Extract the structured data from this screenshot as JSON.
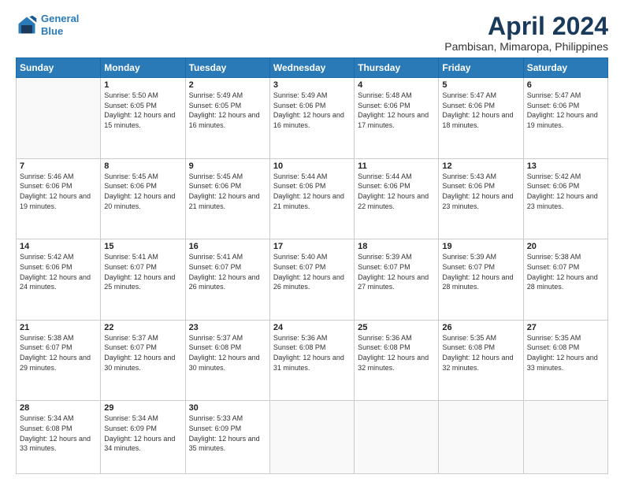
{
  "logo": {
    "line1": "General",
    "line2": "Blue"
  },
  "title": "April 2024",
  "subtitle": "Pambisan, Mimaropa, Philippines",
  "weekdays": [
    "Sunday",
    "Monday",
    "Tuesday",
    "Wednesday",
    "Thursday",
    "Friday",
    "Saturday"
  ],
  "weeks": [
    [
      {
        "day": "",
        "sunrise": "",
        "sunset": "",
        "daylight": ""
      },
      {
        "day": "1",
        "sunrise": "Sunrise: 5:50 AM",
        "sunset": "Sunset: 6:05 PM",
        "daylight": "Daylight: 12 hours and 15 minutes."
      },
      {
        "day": "2",
        "sunrise": "Sunrise: 5:49 AM",
        "sunset": "Sunset: 6:05 PM",
        "daylight": "Daylight: 12 hours and 16 minutes."
      },
      {
        "day": "3",
        "sunrise": "Sunrise: 5:49 AM",
        "sunset": "Sunset: 6:06 PM",
        "daylight": "Daylight: 12 hours and 16 minutes."
      },
      {
        "day": "4",
        "sunrise": "Sunrise: 5:48 AM",
        "sunset": "Sunset: 6:06 PM",
        "daylight": "Daylight: 12 hours and 17 minutes."
      },
      {
        "day": "5",
        "sunrise": "Sunrise: 5:47 AM",
        "sunset": "Sunset: 6:06 PM",
        "daylight": "Daylight: 12 hours and 18 minutes."
      },
      {
        "day": "6",
        "sunrise": "Sunrise: 5:47 AM",
        "sunset": "Sunset: 6:06 PM",
        "daylight": "Daylight: 12 hours and 19 minutes."
      }
    ],
    [
      {
        "day": "7",
        "sunrise": "Sunrise: 5:46 AM",
        "sunset": "Sunset: 6:06 PM",
        "daylight": "Daylight: 12 hours and 19 minutes."
      },
      {
        "day": "8",
        "sunrise": "Sunrise: 5:45 AM",
        "sunset": "Sunset: 6:06 PM",
        "daylight": "Daylight: 12 hours and 20 minutes."
      },
      {
        "day": "9",
        "sunrise": "Sunrise: 5:45 AM",
        "sunset": "Sunset: 6:06 PM",
        "daylight": "Daylight: 12 hours and 21 minutes."
      },
      {
        "day": "10",
        "sunrise": "Sunrise: 5:44 AM",
        "sunset": "Sunset: 6:06 PM",
        "daylight": "Daylight: 12 hours and 21 minutes."
      },
      {
        "day": "11",
        "sunrise": "Sunrise: 5:44 AM",
        "sunset": "Sunset: 6:06 PM",
        "daylight": "Daylight: 12 hours and 22 minutes."
      },
      {
        "day": "12",
        "sunrise": "Sunrise: 5:43 AM",
        "sunset": "Sunset: 6:06 PM",
        "daylight": "Daylight: 12 hours and 23 minutes."
      },
      {
        "day": "13",
        "sunrise": "Sunrise: 5:42 AM",
        "sunset": "Sunset: 6:06 PM",
        "daylight": "Daylight: 12 hours and 23 minutes."
      }
    ],
    [
      {
        "day": "14",
        "sunrise": "Sunrise: 5:42 AM",
        "sunset": "Sunset: 6:06 PM",
        "daylight": "Daylight: 12 hours and 24 minutes."
      },
      {
        "day": "15",
        "sunrise": "Sunrise: 5:41 AM",
        "sunset": "Sunset: 6:07 PM",
        "daylight": "Daylight: 12 hours and 25 minutes."
      },
      {
        "day": "16",
        "sunrise": "Sunrise: 5:41 AM",
        "sunset": "Sunset: 6:07 PM",
        "daylight": "Daylight: 12 hours and 26 minutes."
      },
      {
        "day": "17",
        "sunrise": "Sunrise: 5:40 AM",
        "sunset": "Sunset: 6:07 PM",
        "daylight": "Daylight: 12 hours and 26 minutes."
      },
      {
        "day": "18",
        "sunrise": "Sunrise: 5:39 AM",
        "sunset": "Sunset: 6:07 PM",
        "daylight": "Daylight: 12 hours and 27 minutes."
      },
      {
        "day": "19",
        "sunrise": "Sunrise: 5:39 AM",
        "sunset": "Sunset: 6:07 PM",
        "daylight": "Daylight: 12 hours and 28 minutes."
      },
      {
        "day": "20",
        "sunrise": "Sunrise: 5:38 AM",
        "sunset": "Sunset: 6:07 PM",
        "daylight": "Daylight: 12 hours and 28 minutes."
      }
    ],
    [
      {
        "day": "21",
        "sunrise": "Sunrise: 5:38 AM",
        "sunset": "Sunset: 6:07 PM",
        "daylight": "Daylight: 12 hours and 29 minutes."
      },
      {
        "day": "22",
        "sunrise": "Sunrise: 5:37 AM",
        "sunset": "Sunset: 6:07 PM",
        "daylight": "Daylight: 12 hours and 30 minutes."
      },
      {
        "day": "23",
        "sunrise": "Sunrise: 5:37 AM",
        "sunset": "Sunset: 6:08 PM",
        "daylight": "Daylight: 12 hours and 30 minutes."
      },
      {
        "day": "24",
        "sunrise": "Sunrise: 5:36 AM",
        "sunset": "Sunset: 6:08 PM",
        "daylight": "Daylight: 12 hours and 31 minutes."
      },
      {
        "day": "25",
        "sunrise": "Sunrise: 5:36 AM",
        "sunset": "Sunset: 6:08 PM",
        "daylight": "Daylight: 12 hours and 32 minutes."
      },
      {
        "day": "26",
        "sunrise": "Sunrise: 5:35 AM",
        "sunset": "Sunset: 6:08 PM",
        "daylight": "Daylight: 12 hours and 32 minutes."
      },
      {
        "day": "27",
        "sunrise": "Sunrise: 5:35 AM",
        "sunset": "Sunset: 6:08 PM",
        "daylight": "Daylight: 12 hours and 33 minutes."
      }
    ],
    [
      {
        "day": "28",
        "sunrise": "Sunrise: 5:34 AM",
        "sunset": "Sunset: 6:08 PM",
        "daylight": "Daylight: 12 hours and 33 minutes."
      },
      {
        "day": "29",
        "sunrise": "Sunrise: 5:34 AM",
        "sunset": "Sunset: 6:09 PM",
        "daylight": "Daylight: 12 hours and 34 minutes."
      },
      {
        "day": "30",
        "sunrise": "Sunrise: 5:33 AM",
        "sunset": "Sunset: 6:09 PM",
        "daylight": "Daylight: 12 hours and 35 minutes."
      },
      {
        "day": "",
        "sunrise": "",
        "sunset": "",
        "daylight": ""
      },
      {
        "day": "",
        "sunrise": "",
        "sunset": "",
        "daylight": ""
      },
      {
        "day": "",
        "sunrise": "",
        "sunset": "",
        "daylight": ""
      },
      {
        "day": "",
        "sunrise": "",
        "sunset": "",
        "daylight": ""
      }
    ]
  ]
}
